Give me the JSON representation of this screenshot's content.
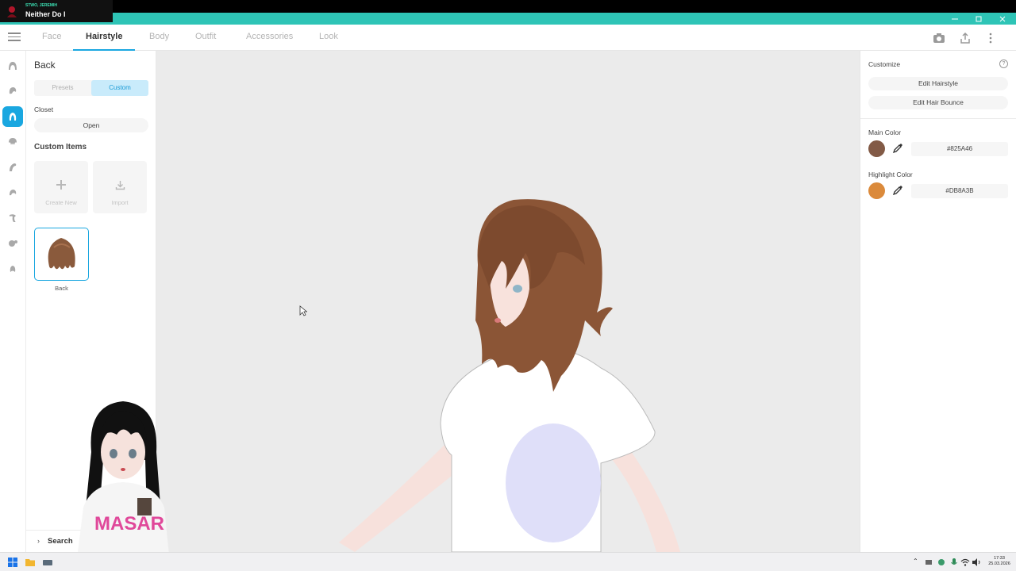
{
  "now_playing": {
    "artist": "STWO, JEREMIH",
    "title": "Neither Do I"
  },
  "nav": {
    "tabs": [
      {
        "label": "Face"
      },
      {
        "label": "Hairstyle"
      },
      {
        "label": "Body"
      },
      {
        "label": "Outfit"
      },
      {
        "label": "Accessories"
      },
      {
        "label": "Look"
      }
    ],
    "active_tab": "Hairstyle"
  },
  "left_panel": {
    "back_label": "Back",
    "segment": {
      "presets": "Presets",
      "custom": "Custom",
      "selected": "Custom"
    },
    "closet_label": "Closet",
    "open_button": "Open",
    "custom_items_label": "Custom Items",
    "create_new": "Create New",
    "import": "Import",
    "item": {
      "label": "Back"
    },
    "search_label": "Search"
  },
  "right_panel": {
    "customize_label": "Customize",
    "edit_hairstyle": "Edit Hairstyle",
    "edit_hair_bounce": "Edit Hair Bounce",
    "main_color_label": "Main Color",
    "main_color_hex": "#825A46",
    "highlight_color_label": "Highlight Color",
    "highlight_color_hex": "#DB8A3B"
  },
  "overlay": {
    "shirt_text": "MASAR"
  },
  "taskbar": {
    "time": "17:33",
    "date": "25.03.2026"
  },
  "colors": {
    "accent": "#1aa7e0",
    "titlebar": "#2ec4b6",
    "main_color": "#825A46",
    "highlight_color": "#DB8A3B"
  }
}
